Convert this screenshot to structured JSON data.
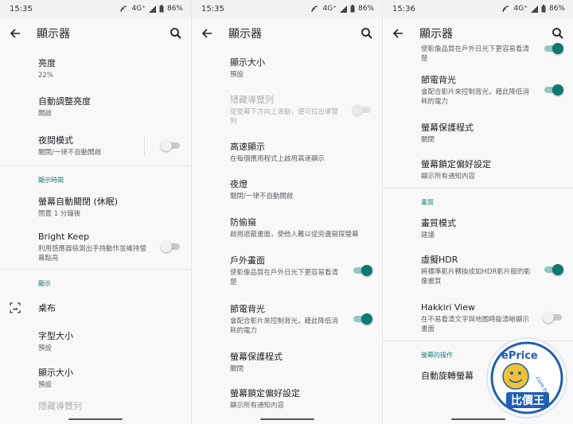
{
  "screens": [
    {
      "status": {
        "time": "15:35",
        "network": "4G⁺",
        "battery": "86%"
      },
      "title": "顯示器",
      "items": [
        {
          "title": "亮度",
          "subtitle": "22%"
        },
        {
          "title": "自動調整亮度",
          "subtitle": "開啟"
        },
        {
          "title": "夜間模式",
          "subtitle": "關閉/一律不自動開啟"
        },
        {
          "section": "顯示時間"
        },
        {
          "title": "螢幕自動關閉 (休眠)",
          "subtitle": "閒置 1 分鐘後"
        },
        {
          "title": "Bright Keep",
          "subtitle": "利用感應器檢測出手持動作並維持螢幕點亮"
        },
        {
          "section": "顯示"
        },
        {
          "title": "桌布"
        },
        {
          "title": "字型大小",
          "subtitle": "預設"
        },
        {
          "title": "顯示大小",
          "subtitle": "預設"
        },
        {
          "title": "隱藏導覽列"
        }
      ]
    },
    {
      "status": {
        "time": "15:35",
        "network": "4G⁺",
        "battery": "86%"
      },
      "title": "顯示器",
      "items": [
        {
          "title": "顯示大小",
          "subtitle": "預設"
        },
        {
          "title": "隱藏導覽列",
          "subtitle": "從螢幕下方向上滑動，便可拉出導覽列"
        },
        {
          "title": "高速顯示",
          "subtitle": "在每個應用程式上啟用高速顯示"
        },
        {
          "title": "夜燈",
          "subtitle": "關閉/一律不自動開啟"
        },
        {
          "title": "防偷窺",
          "subtitle": "啟用遮蔽畫面，使他人難以從旁邊窺探螢幕"
        },
        {
          "title": "戶外畫面",
          "subtitle": "使影像品質在戶外日光下更容易看清楚"
        },
        {
          "title": "節電背光",
          "subtitle": "會配合影片來控制背光，藉此降低消耗的電力"
        },
        {
          "title": "螢幕保護程式",
          "subtitle": "關閉"
        },
        {
          "title": "螢幕鎖定偏好設定",
          "subtitle": "顯示所有通知內容"
        }
      ]
    },
    {
      "status": {
        "time": "15:36",
        "network": "4G⁺",
        "battery": "86%"
      },
      "title": "顯示器",
      "items": [
        {
          "subtitle": "使影像品質在戶外日光下更容易看清楚"
        },
        {
          "title": "節電背光",
          "subtitle": "會配合影片來控制背光，藉此降低消耗的電力"
        },
        {
          "title": "螢幕保護程式",
          "subtitle": "關閉"
        },
        {
          "title": "螢幕鎖定偏好設定",
          "subtitle": "顯示所有通知內容"
        },
        {
          "section": "畫質"
        },
        {
          "title": "畫質模式",
          "subtitle": "建議"
        },
        {
          "title": "虛擬HDR",
          "subtitle": "將標準影片轉換成如HDR影片般的影像畫質"
        },
        {
          "title": "Hakkiri View",
          "subtitle": "在不易看清文字與地圖時能清晰顯示畫面"
        },
        {
          "section": "螢幕的操作"
        },
        {
          "title": "自動旋轉螢幕"
        }
      ]
    }
  ],
  "colors": {
    "accent": "#0b7a6f",
    "section": "#1a7f77"
  },
  "watermark": {
    "brand": "ePrice",
    "domain": ".com.tw",
    "chinese": "比價王"
  }
}
